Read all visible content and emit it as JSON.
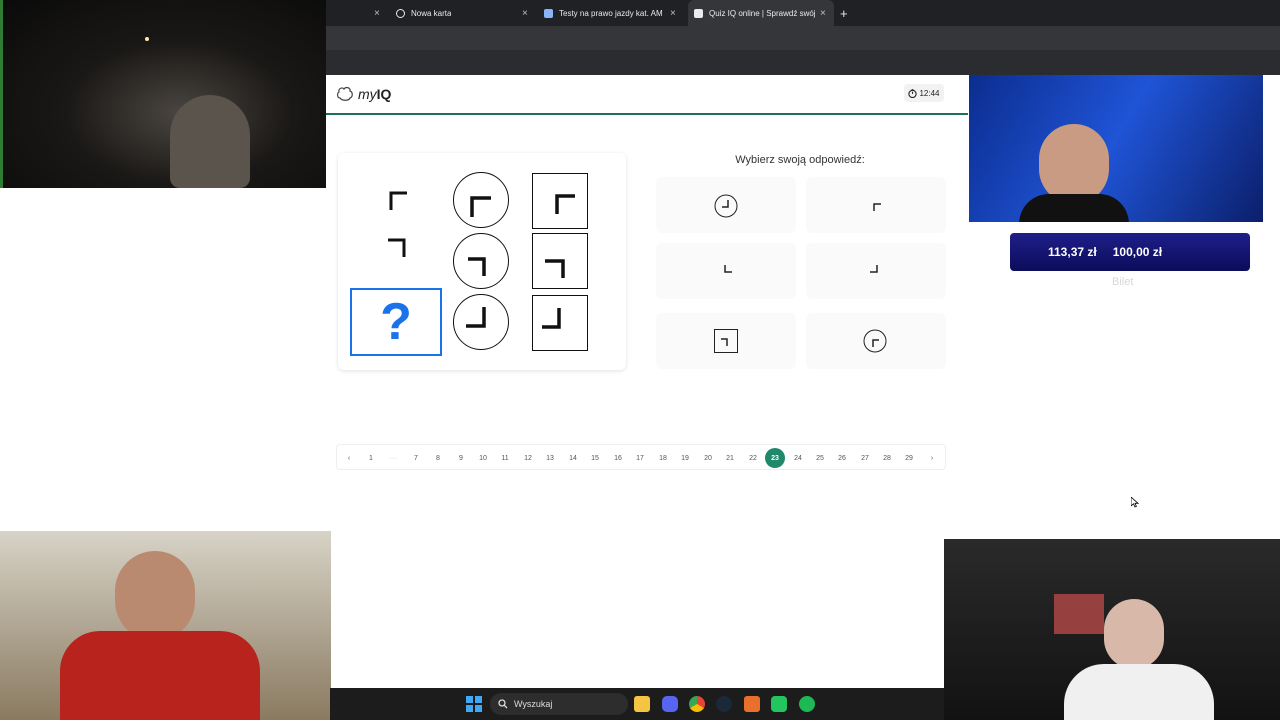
{
  "browser": {
    "tabs": [
      {
        "label": "",
        "favicon_color": "#e8eaed"
      },
      {
        "label": "Nowa karta",
        "favicon_color": "#e8eaed"
      },
      {
        "label": "Testy na prawo jazdy kat. AM",
        "favicon_color": "#8ab4f8"
      },
      {
        "label": "Quiz IQ online | Sprawdź swój",
        "favicon_color": "#e8eaed"
      }
    ],
    "close_glyph": "×",
    "new_tab_glyph": "+"
  },
  "site": {
    "logo_my": "my",
    "logo_iq": "IQ",
    "timer": "12:44"
  },
  "puzzle": {
    "question_mark": "?"
  },
  "answers": {
    "heading": "Wybierz swoją odpowiedź:"
  },
  "pagination": {
    "prev": "‹",
    "next": "›",
    "ellipsis": "···",
    "pages": [
      "1",
      "7",
      "8",
      "9",
      "10",
      "11",
      "12",
      "13",
      "14",
      "15",
      "16",
      "17",
      "18",
      "19",
      "20",
      "21",
      "22",
      "23",
      "24",
      "25",
      "26",
      "27",
      "28",
      "29"
    ],
    "current": "23"
  },
  "overlay": {
    "bet_amount_1": "113,37 zł",
    "bet_amount_2": "100,00 zł",
    "bet_label": "Bilet"
  },
  "taskbar": {
    "search_label": "Wyszukaj",
    "icons": [
      "windows-start-icon",
      "file-explorer-icon",
      "discord-icon",
      "chrome-icon",
      "steam-icon",
      "app-icon",
      "app-green-icon",
      "spotify-icon"
    ]
  }
}
